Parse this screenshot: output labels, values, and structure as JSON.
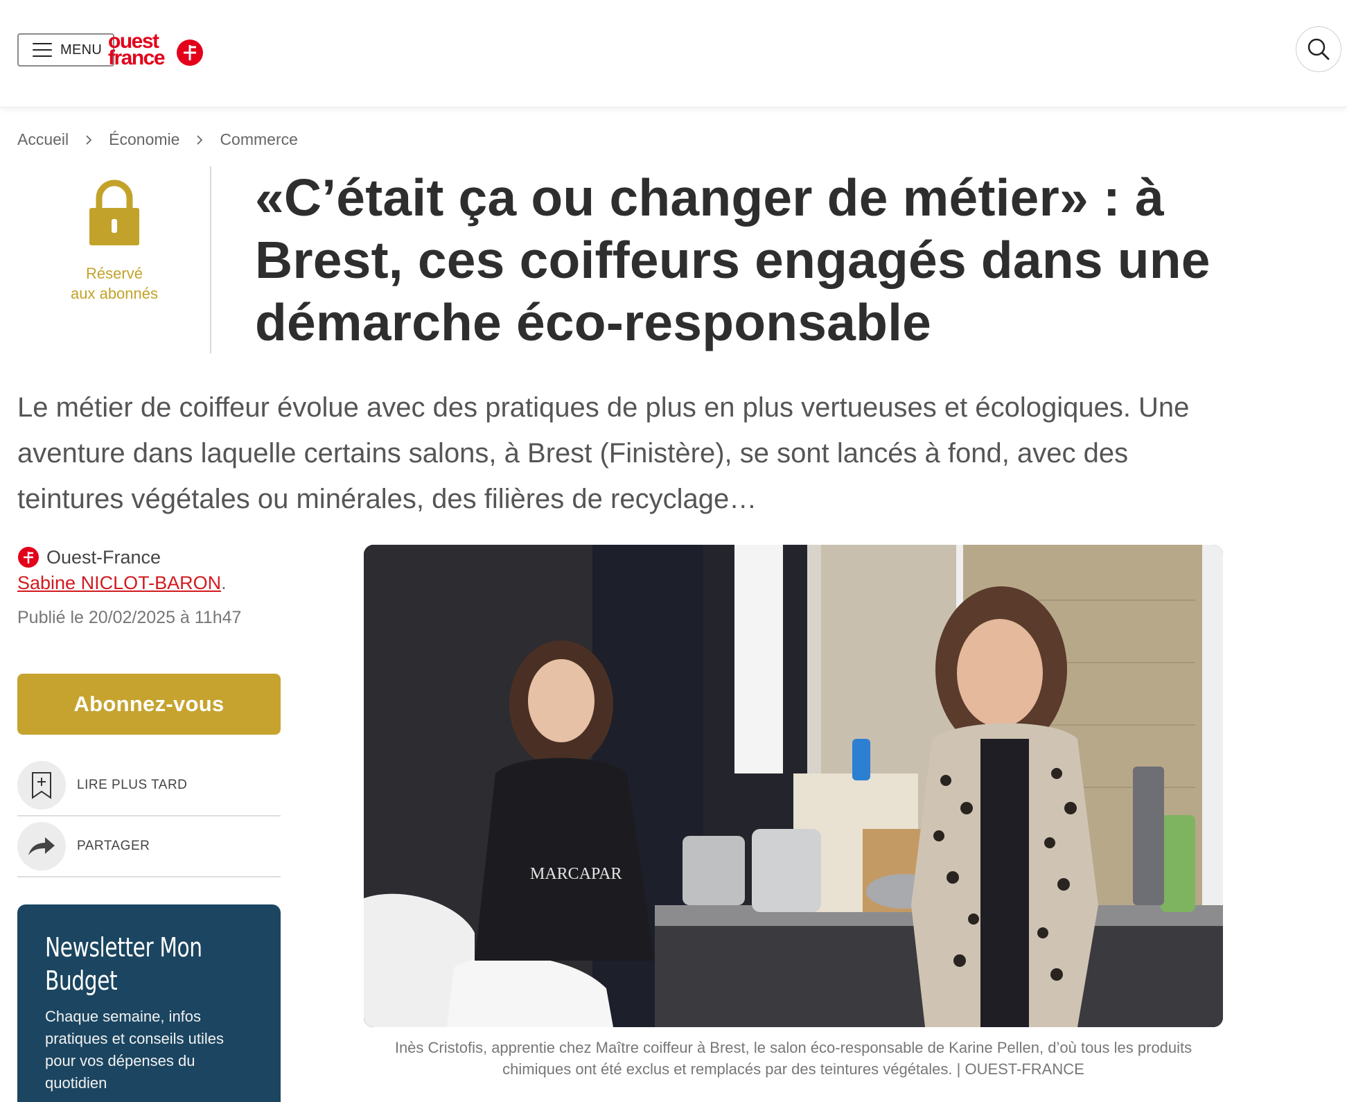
{
  "header": {
    "menu_label": "MENU",
    "logo_line1": "ouest",
    "logo_line2": "france",
    "brand_color": "#e2001a",
    "search_icon": "search-icon"
  },
  "breadcrumb": {
    "items": [
      "Accueil",
      "Économie",
      "Commerce"
    ]
  },
  "premium": {
    "line1": "Réservé",
    "line2": "aux abonnés",
    "color": "#c2a22a"
  },
  "article": {
    "title": "«C’était ça ou changer de métier» : à Brest, ces coiffeurs engagés dans une démarche éco-responsable",
    "lead": "Le métier de coiffeur évolue avec des pratiques de plus en plus vertueuses et écologiques. Une aventure dans laquelle certains salons, à Brest (Finistère), se sont lancés à fond, avec des teintures végétales ou minérales, des filières de recyclage…",
    "source": "Ouest-France",
    "author": "Sabine NICLOT-BARON",
    "author_suffix": ".",
    "published": "Publié le 20/02/2025 à 11h47",
    "photo_apron_text": "MARCAPAR",
    "caption": "Inès Cristofis, apprentie chez Maître coiffeur à Brest, le salon éco-responsable de Karine Pellen, d’où tous les produits chimiques ont été exclus et remplacés par des teintures végétales. | OUEST-FRANCE"
  },
  "sidebar": {
    "subscribe_label": "Abonnez-vous",
    "subscribe_color": "#c6a32f",
    "read_later_label": "LIRE PLUS TARD",
    "share_label": "PARTAGER",
    "newsletter_title": "Newsletter Mon Budget",
    "newsletter_desc": "Chaque semaine, infos pratiques et conseils utiles pour vos dépenses du quotidien",
    "newsletter_color": "#1b4560"
  }
}
